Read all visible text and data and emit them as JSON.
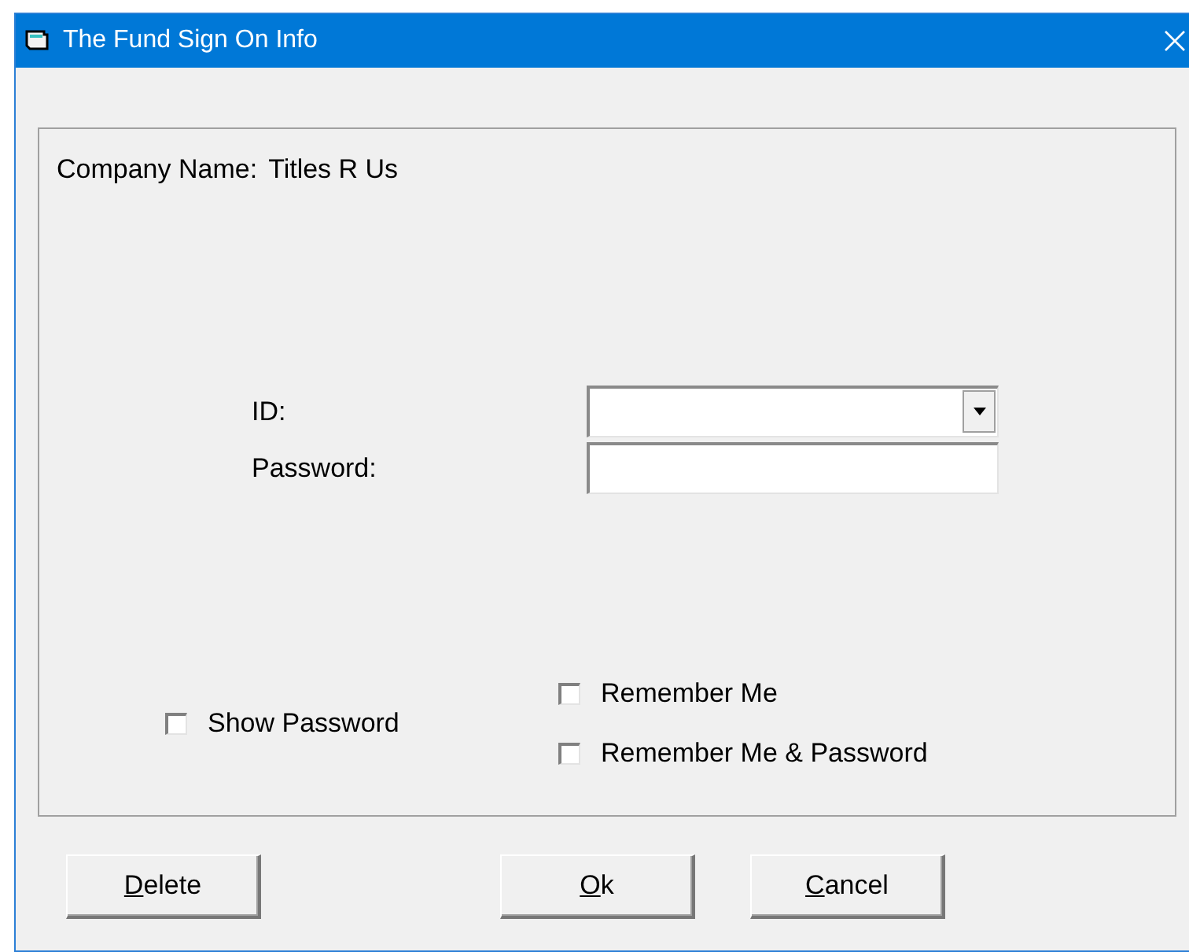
{
  "window": {
    "title": "The Fund Sign On Info"
  },
  "company": {
    "label": "Company Name:",
    "value": "Titles R Us"
  },
  "fields": [
    {
      "label": "ID:",
      "kind": "dropdown"
    },
    {
      "label": "Password:",
      "kind": "text"
    }
  ],
  "checkboxes": [
    {
      "label": "Show Password",
      "checked": false
    },
    {
      "label": "Remember Me",
      "checked": false
    },
    {
      "label": "Remember Me & Password",
      "checked": false
    }
  ],
  "buttons": [
    {
      "label": "Delete",
      "underline_first": true
    },
    {
      "label": "Ok",
      "underline_first": true
    },
    {
      "label": "Cancel",
      "underline_first": true
    }
  ]
}
